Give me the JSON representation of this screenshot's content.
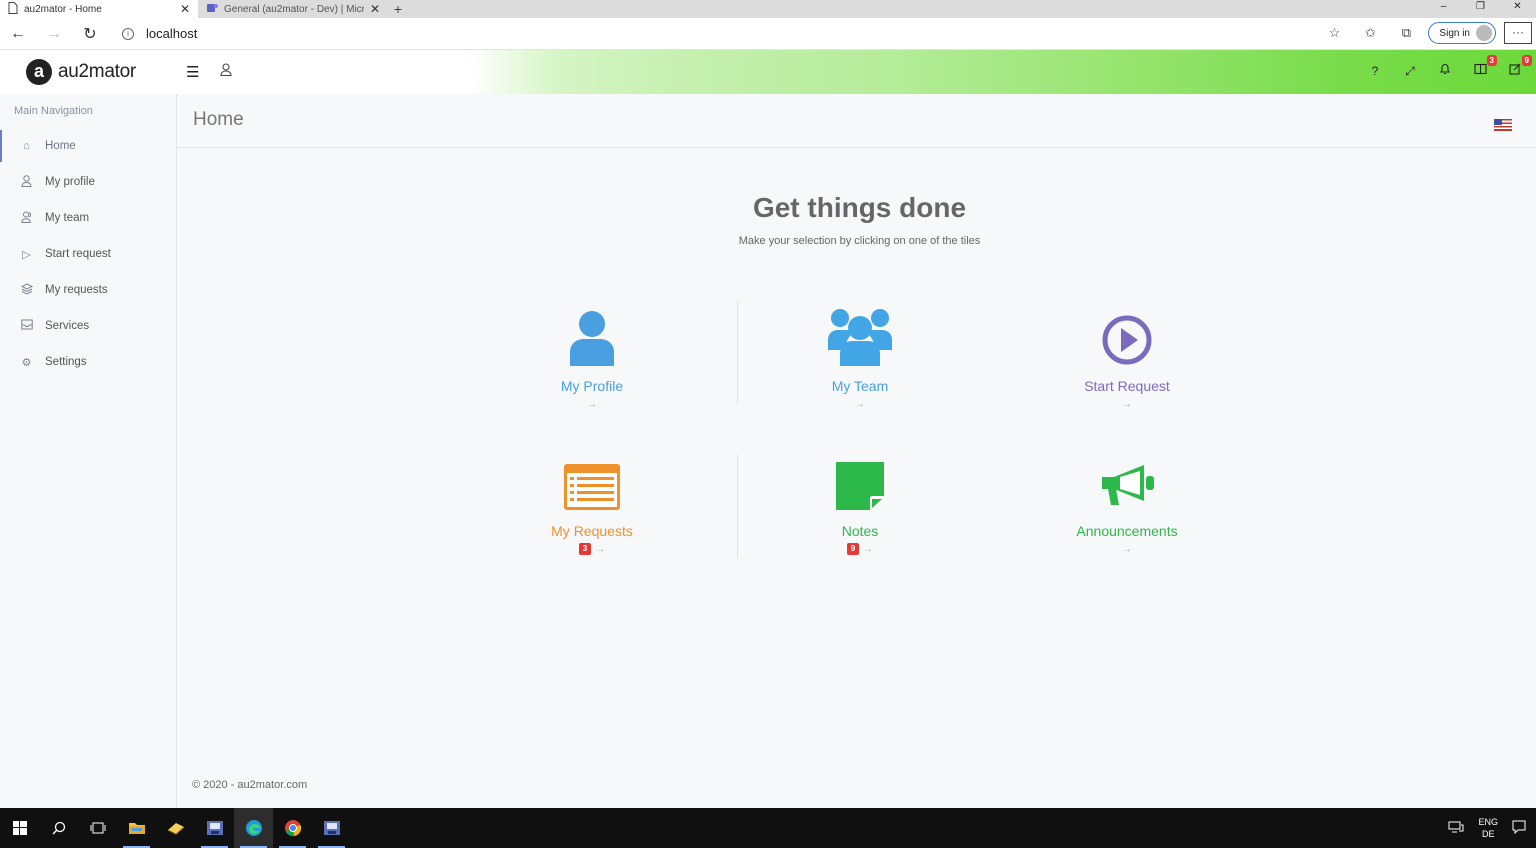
{
  "browser": {
    "tabs": [
      {
        "title": "au2mator - Home",
        "active": true
      },
      {
        "title": "General (au2mator - Dev) | Micr",
        "active": false
      }
    ],
    "url": "localhost",
    "signin_label": "Sign in",
    "more_label": "···"
  },
  "header": {
    "logo_mark": "a",
    "logo_text": "au2mator",
    "icons": [
      {
        "name": "help-icon",
        "glyph": "?"
      },
      {
        "name": "fullscreen-icon",
        "glyph": "⤢"
      },
      {
        "name": "bell-icon",
        "glyph": "🔔"
      },
      {
        "name": "book-icon",
        "glyph": "▤",
        "badge": "3"
      },
      {
        "name": "edit-icon",
        "glyph": "✎",
        "badge": "9"
      }
    ]
  },
  "sidebar": {
    "heading": "Main Navigation",
    "items": [
      {
        "label": "Home",
        "icon": "home-icon"
      },
      {
        "label": "My profile",
        "icon": "user-icon"
      },
      {
        "label": "My team",
        "icon": "team-icon"
      },
      {
        "label": "Start request",
        "icon": "play-icon"
      },
      {
        "label": "My requests",
        "icon": "layers-icon"
      },
      {
        "label": "Services",
        "icon": "inbox-icon"
      },
      {
        "label": "Settings",
        "icon": "gear-icon"
      }
    ]
  },
  "page": {
    "title": "Home",
    "hero_title": "Get things done",
    "hero_subtitle": "Make your selection by clicking on one of the tiles"
  },
  "tiles": [
    {
      "label": "My Profile",
      "color": "#4a9fe0",
      "arrow": "→"
    },
    {
      "label": "My Team",
      "color": "#4a9fe0",
      "arrow": "→"
    },
    {
      "label": "Start Request",
      "color": "#7b6bbf",
      "arrow": "→"
    },
    {
      "label": "My Requests",
      "color": "#f0902a",
      "arrow": "→",
      "badge": "3"
    },
    {
      "label": "Notes",
      "color": "#2db84a",
      "arrow": "→",
      "badge": "9"
    },
    {
      "label": "Announcements",
      "color": "#2db84a",
      "arrow": "→"
    }
  ],
  "footer": {
    "text": "© 2020 - au2mator.com"
  },
  "taskbar": {
    "lang_top": "ENG",
    "lang_bottom": "DE"
  }
}
